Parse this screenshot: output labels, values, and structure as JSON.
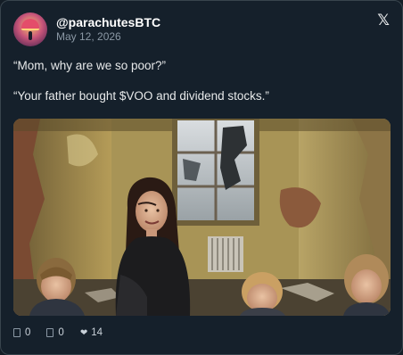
{
  "post": {
    "handle": "@parachutesBTC",
    "date": "May 12, 2026",
    "lines": [
      "“Mom, why are we so poor?”",
      "“Your father bought $VOO and dividend stocks.”"
    ]
  },
  "platform_icon": "x-logo-icon",
  "media": {
    "description_icon": "photo",
    "scene": "mother-and-children-in-dilapidated-room"
  },
  "actions": {
    "replies": "0",
    "reposts": "0",
    "likes": "14"
  },
  "colors": {
    "background": "#15202b",
    "border": "#38444d",
    "text": "#e7e9ea",
    "muted": "#8b98a5"
  }
}
